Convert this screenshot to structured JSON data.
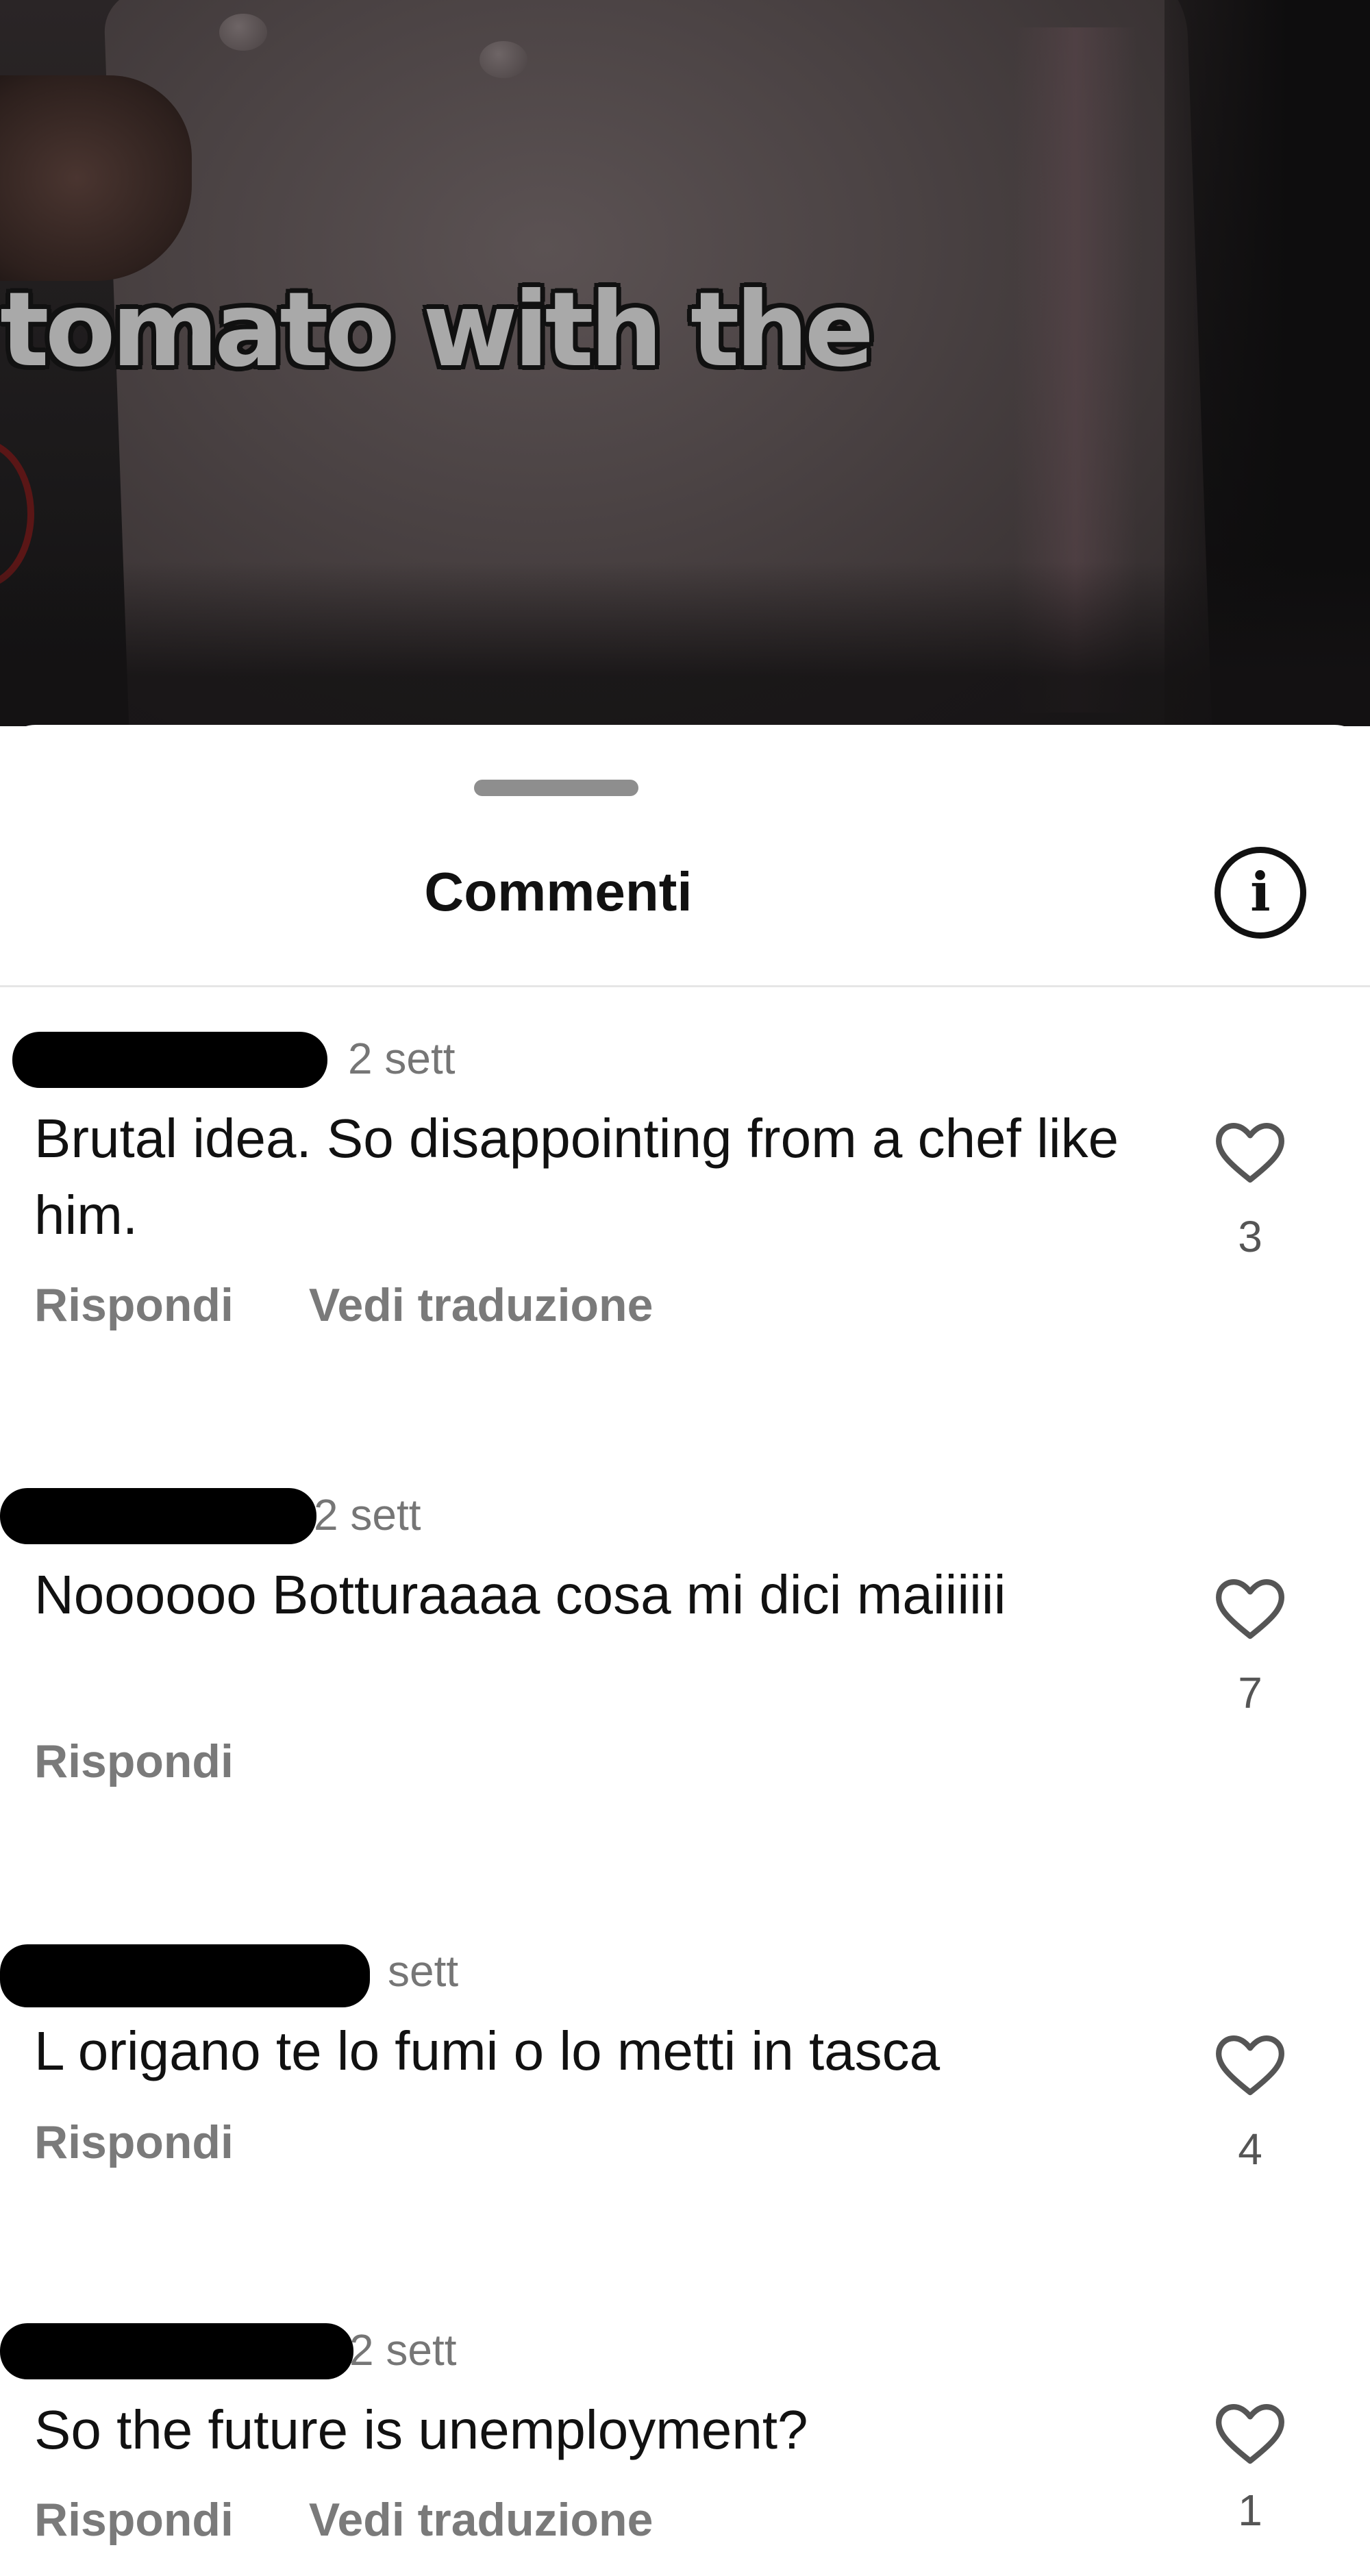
{
  "video": {
    "caption": "tomato with the"
  },
  "comments_sheet": {
    "title": "Commenti",
    "info_icon": "info-icon",
    "comments": [
      {
        "time": "2 sett",
        "text": "Brutal idea. So disappointing from a chef like him.",
        "likes": "3",
        "actions": {
          "reply": "Rispondi",
          "translate": "Vedi traduzione"
        }
      },
      {
        "time": "2 sett",
        "text": "Noooooo Botturaaaa cosa mi dici maiiiiii",
        "likes": "7",
        "actions": {
          "reply": "Rispondi"
        }
      },
      {
        "time": "sett",
        "text": "L origano te lo fumi o lo metti in tasca",
        "likes": "4",
        "actions": {
          "reply": "Rispondi"
        }
      },
      {
        "time": "2 sett",
        "text": "So the future is unemployment?",
        "likes": "1",
        "actions": {
          "reply": "Rispondi",
          "translate": "Vedi traduzione"
        }
      }
    ]
  }
}
